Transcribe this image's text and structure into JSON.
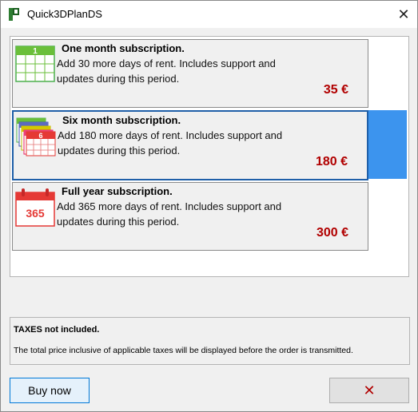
{
  "window": {
    "title": "Quick3DPlanDS",
    "close_glyph": "✕"
  },
  "subscriptions": [
    {
      "title": "One month subscription.",
      "description": "Add 30 more days of rent. Includes support and updates during this period.",
      "price": "35 €",
      "icon": "calendar-one-month-icon",
      "icon_label": "1",
      "selected": false
    },
    {
      "title": "Six month subscription.",
      "description": "Add 180 more days of rent. Includes support and updates during this period.",
      "price": "180 €",
      "icon": "calendar-six-month-icon",
      "icon_label": "6",
      "selected": true
    },
    {
      "title": "Full year subscription.",
      "description": "Add 365 more days of rent. Includes support and updates during this period.",
      "price": "300 €",
      "icon": "calendar-full-year-icon",
      "icon_label": "365",
      "selected": false
    }
  ],
  "taxes": {
    "title": "TAXES not included.",
    "text": "The total price inclusive of applicable taxes will be displayed before the order is transmitted."
  },
  "buttons": {
    "buy_label": "Buy now",
    "cancel_glyph": "✕"
  },
  "colors": {
    "price": "#b10000",
    "selection": "#3c94ee",
    "selection_border": "#1f5fa8"
  }
}
